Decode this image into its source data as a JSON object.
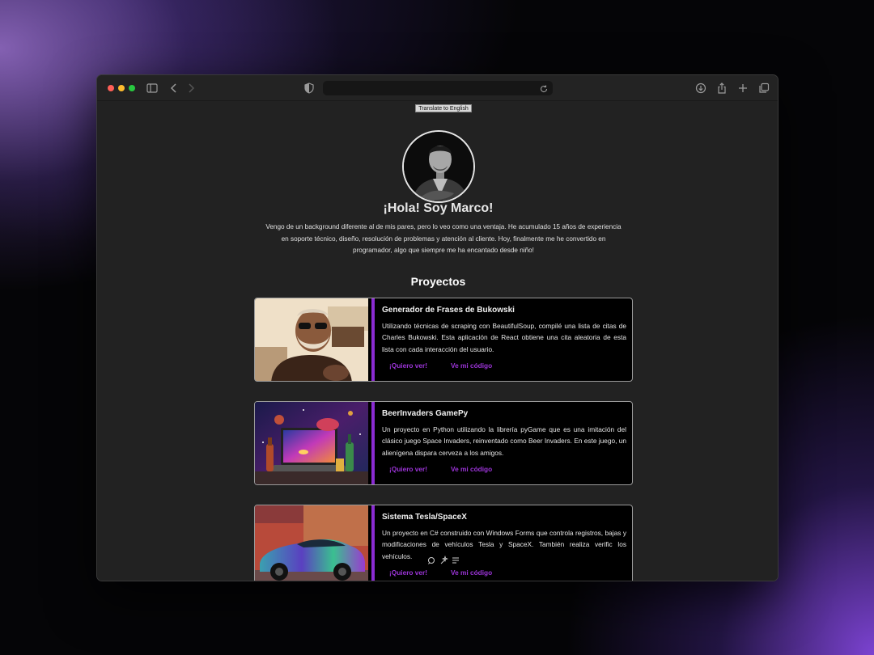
{
  "browser": {
    "url": "",
    "icons": [
      "sidebar-icon",
      "back-icon",
      "forward-icon",
      "shield-icon",
      "reload-icon",
      "download-icon",
      "share-icon",
      "new-tab-icon",
      "tabs-overview-icon"
    ]
  },
  "page": {
    "translate_button": "Translate to English",
    "hero": {
      "title": "¡Hola! Soy Marco!",
      "text": "Vengo de un background diferente al de mis pares, pero lo veo como una ventaja. He acumulado 15 años de experiencia en soporte técnico, diseño, resolución de problemas y atención al cliente. Hoy, finalmente me he convertido en programador, algo que siempre me ha encantado desde niño!"
    },
    "projects_title": "Proyectos",
    "projects": [
      {
        "title": "Generador de Frases de Bukowski",
        "description": "Utilizando técnicas de scraping con BeautifulSoup, compilé una lista de citas de Charles Bukowski. Esta aplicación de React obtiene una cita aleatoria de esta lista con cada interacción del usuario.",
        "demo_label": "¡Quiero ver!",
        "code_label": "Ve mi código"
      },
      {
        "title": "BeerInvaders GamePy",
        "description": "Un proyecto en Python utilizando la librería pyGame que es una imitación del clásico juego Space Invaders, reinventado como Beer Invaders. En este juego, un alienígena dispara cerveza a los amigos.",
        "demo_label": "¡Quiero ver!",
        "code_label": "Ve mi código"
      },
      {
        "title": "Sistema Tesla/SpaceX",
        "description": "Un proyecto en C# construido con Windows Forms que controla registros, bajas y modificaciones de vehículos Tesla y SpaceX. También realiza verific             los vehículos.",
        "demo_label": "¡Quiero ver!",
        "code_label": "Ve mi código"
      }
    ]
  },
  "colors": {
    "accent": "#8a2bd2",
    "link": "#9c34d8",
    "page_bg": "#222222",
    "card_bg": "#000000"
  }
}
